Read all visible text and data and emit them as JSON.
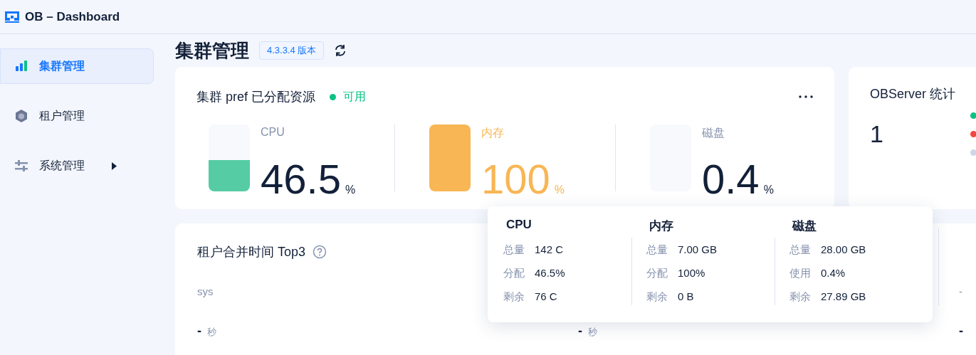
{
  "app": {
    "title": "OB – Dashboard"
  },
  "sidebar": {
    "items": [
      {
        "kind": "cluster",
        "label": "集群管理",
        "selected": true,
        "expandable": false
      },
      {
        "kind": "tenant",
        "label": "租户管理",
        "selected": false,
        "expandable": false
      },
      {
        "kind": "system",
        "label": "系统管理",
        "selected": false,
        "expandable": true
      }
    ]
  },
  "page": {
    "title": "集群管理",
    "version": "4.3.3.4 版本"
  },
  "resources": {
    "title": "集群 pref 已分配资源",
    "status": {
      "label": "可用",
      "color": "#0ac185"
    },
    "items": [
      {
        "label": "CPU",
        "value": "46.5",
        "unit": "%",
        "level": 0.465,
        "warning": false
      },
      {
        "label": "内存",
        "value": "100",
        "unit": "%",
        "level": 1,
        "warning": true
      },
      {
        "label": "磁盘",
        "value": "0.4",
        "unit": "%",
        "level": 0.004,
        "warning": false
      }
    ]
  },
  "observer": {
    "title": "OBServer 统计",
    "count": "1",
    "statuses": [
      {
        "color": "#0ac185"
      },
      {
        "color": "#f5473f"
      },
      {
        "color": "#d0d6e6"
      }
    ]
  },
  "compaction": {
    "title": "租户合并时间 Top3",
    "tenants": [
      {
        "name": "sys",
        "value": "-",
        "unit": "秒"
      },
      {
        "value": "-",
        "unit": "秒"
      },
      {
        "name": "-",
        "value": "-"
      }
    ]
  },
  "popover": {
    "columns": [
      {
        "title": "CPU",
        "rows": [
          {
            "label": "总量",
            "value": "142 C"
          },
          {
            "label": "分配",
            "value": "46.5%"
          },
          {
            "label": "剩余",
            "value": "76 C"
          }
        ]
      },
      {
        "title": "内存",
        "rows": [
          {
            "label": "总量",
            "value": "7.00 GB"
          },
          {
            "label": "分配",
            "value": "100%"
          },
          {
            "label": "剩余",
            "value": "0 B"
          }
        ]
      },
      {
        "title": "磁盘",
        "rows": [
          {
            "label": "总量",
            "value": "28.00 GB"
          },
          {
            "label": "使用",
            "value": "0.4%"
          },
          {
            "label": "剩余",
            "value": "27.89 GB"
          }
        ]
      }
    ]
  }
}
